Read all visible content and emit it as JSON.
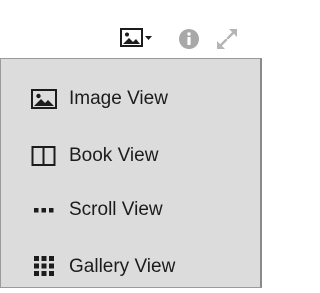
{
  "toolbar": {
    "view_icon": "image-view-icon",
    "info_icon": "info-circle-icon",
    "fullscreen_icon": "expand-icon"
  },
  "menu": {
    "items": [
      {
        "label": "Image View",
        "icon": "image-icon"
      },
      {
        "label": "Book View",
        "icon": "book-icon"
      },
      {
        "label": "Scroll View",
        "icon": "ellipsis-icon"
      },
      {
        "label": "Gallery View",
        "icon": "grid-icon"
      }
    ]
  },
  "colors": {
    "menu_bg": "#dcdcdc",
    "icon_dark": "#1c1c1c",
    "icon_gray": "#a8a8a8"
  }
}
